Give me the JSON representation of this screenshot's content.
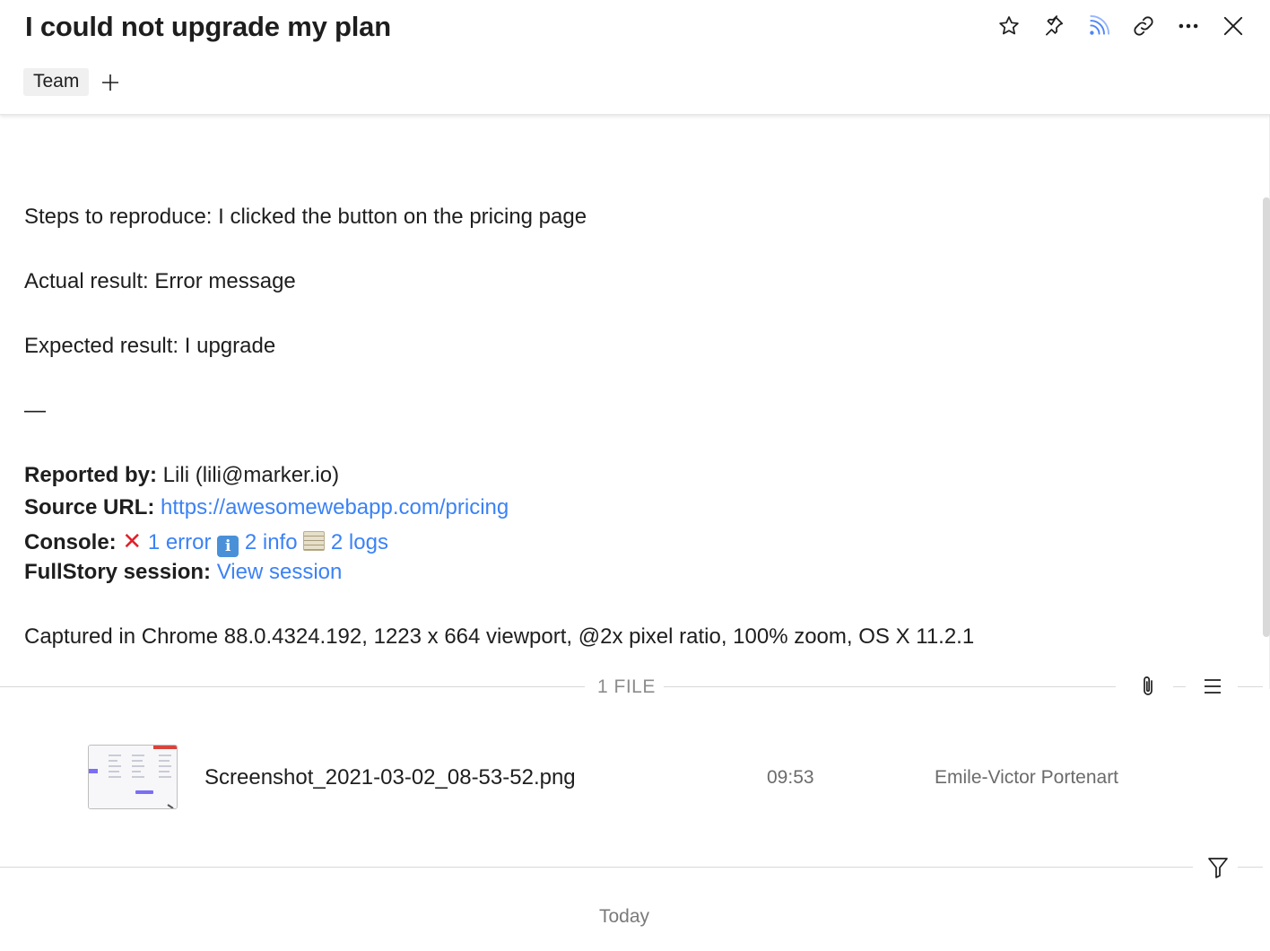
{
  "header": {
    "title": "I could not upgrade my plan",
    "tags": [
      "Team"
    ],
    "toolbar": {
      "icons": [
        "star-icon",
        "pin-icon",
        "rss-icon",
        "link-icon",
        "more-icon",
        "close-icon"
      ],
      "rss_color": "#4f86f7"
    }
  },
  "description": {
    "steps": "Steps to reproduce: I clicked the button on the pricing page",
    "actual": "Actual result: Error message",
    "expected": "Expected result: I upgrade",
    "separator": "—",
    "reported_by_label": "Reported by:",
    "reported_by_value": " Lili (lili@marker.io)",
    "source_url_label": "Source URL:",
    "source_url_value": "https://awesomewebapp.com/pricing",
    "console_label": "Console:",
    "console_error": "1 error",
    "console_info": "2 info",
    "console_logs": "2 logs",
    "fullstory_label": "FullStory session:",
    "fullstory_link": "View session",
    "captured": "Captured in Chrome 88.0.4324.192, 1223 x 664 viewport, @2x pixel ratio, 100% zoom, OS X 11.2.1"
  },
  "files": {
    "label": "1 FILE",
    "items": [
      {
        "name": "Screenshot_2021-03-02_08-53-52.png",
        "time": "09:53",
        "author": "Emile-Victor Portenart"
      }
    ]
  },
  "activity": {
    "day_label": "Today"
  },
  "colors": {
    "link": "#3b82f6",
    "error": "#e0202a",
    "muted": "#8c8c8c"
  }
}
